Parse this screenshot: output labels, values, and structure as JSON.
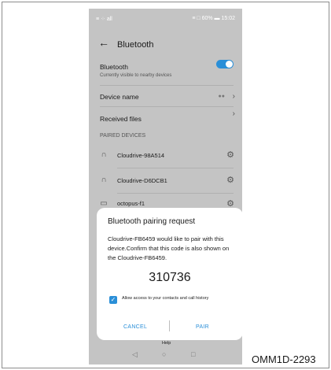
{
  "status_bar": {
    "left": "≡ ⁘ all",
    "right": "≡ □ 60% ▬ 15:02"
  },
  "app_bar": {
    "back_icon": "arrow-left-icon",
    "title": "Bluetooth"
  },
  "bluetooth": {
    "label": "Bluetooth",
    "sublabel": "Currently visible to nearby devices",
    "toggle_state": "on"
  },
  "device_name": {
    "label": "Device name",
    "value": "●●"
  },
  "received_files": {
    "label": "Received files"
  },
  "paired": {
    "header": "PAIRED DEVICES",
    "devices": [
      {
        "name": "Cloudrive-98A514",
        "icon": "headphones-icon"
      },
      {
        "name": "Cloudrive-D6DCB1",
        "icon": "headphones-icon"
      },
      {
        "name": "octopus-f1",
        "icon": "laptop-icon"
      }
    ]
  },
  "dialog": {
    "title": "Bluetooth pairing request",
    "body": "Cloudrive-FB6459 would like to pair with this device.Confirm that this code is also shown on the Cloudrive-FB6459.",
    "code": "310736",
    "checkbox_label": "Allow access to your contacts and call history",
    "checkbox_checked": true,
    "cancel": "CANCEL",
    "pair": "PAIR"
  },
  "help_label": "Help",
  "nav": {
    "back": "◁",
    "home": "○",
    "recent": "□"
  },
  "figure_code": "OMM1D-2293",
  "colors": {
    "accent": "#2a8fd8",
    "overlay": "#c4c4c4",
    "dialog_bg": "#ffffff"
  }
}
